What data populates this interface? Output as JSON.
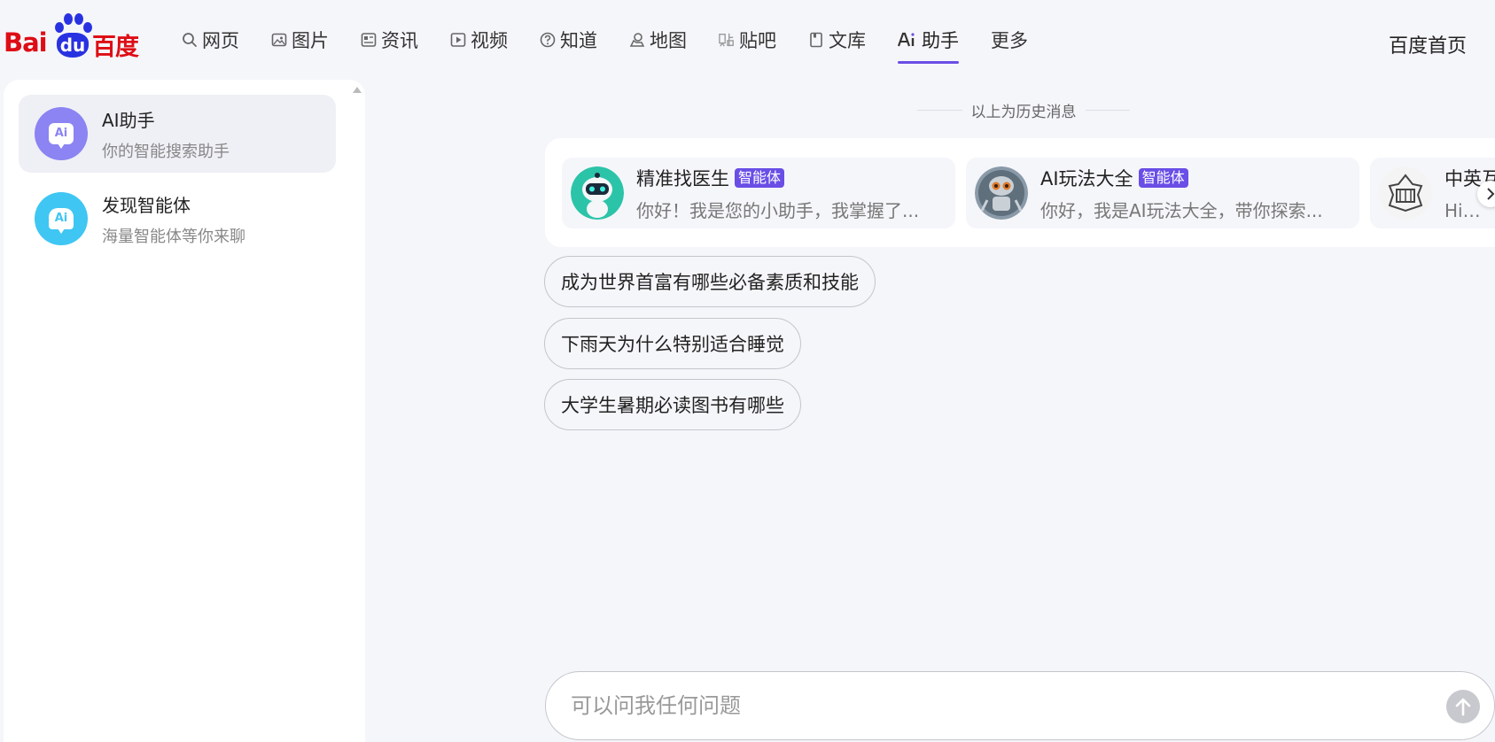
{
  "logo": {
    "text_left": "Bai",
    "text_mid": "du",
    "text_right": "百度"
  },
  "nav": {
    "items": [
      {
        "label": "网页",
        "icon": "search-icon"
      },
      {
        "label": "图片",
        "icon": "image-icon"
      },
      {
        "label": "资讯",
        "icon": "news-icon"
      },
      {
        "label": "视频",
        "icon": "video-icon"
      },
      {
        "label": "知道",
        "icon": "question-icon"
      },
      {
        "label": "地图",
        "icon": "map-pin-icon"
      },
      {
        "label": "贴吧",
        "icon": "tieba-icon"
      },
      {
        "label": "文库",
        "icon": "document-icon"
      },
      {
        "label": "助手",
        "icon": "ai-icon",
        "active": true
      },
      {
        "label": "更多"
      }
    ],
    "home_label": "百度首页"
  },
  "sidebar": {
    "items": [
      {
        "title": "AI助手",
        "subtitle": "你的智能搜索助手",
        "icon": "ai-assistant-icon",
        "color": "#8b84f2",
        "active": true
      },
      {
        "title": "发现智能体",
        "subtitle": "海量智能体等你来聊",
        "icon": "discover-agent-icon",
        "color": "#3fc6f3"
      }
    ]
  },
  "main": {
    "history_label": "以上为历史消息",
    "agents": [
      {
        "name": "精准找医生",
        "tag": "智能体",
        "desc": "你好！我是您的小助手，我掌握了...",
        "avatar": "robot-doctor-avatar"
      },
      {
        "name": "AI玩法大全",
        "tag": "智能体",
        "desc": "你好，我是AI玩法大全，带你探索...",
        "avatar": "robot-avatar"
      },
      {
        "name": "中英互",
        "desc": "Hi，我",
        "avatar": "emblem-avatar"
      }
    ],
    "suggestions": [
      "成为世界首富有哪些必备素质和技能",
      "下雨天为什么特别适合睡觉",
      "大学生暑期必读图书有哪些"
    ]
  },
  "input": {
    "placeholder": "可以问我任何问题"
  },
  "colors": {
    "accent": "#6a4ee6",
    "brand_red": "#de0d15",
    "brand_blue": "#2932e1"
  }
}
